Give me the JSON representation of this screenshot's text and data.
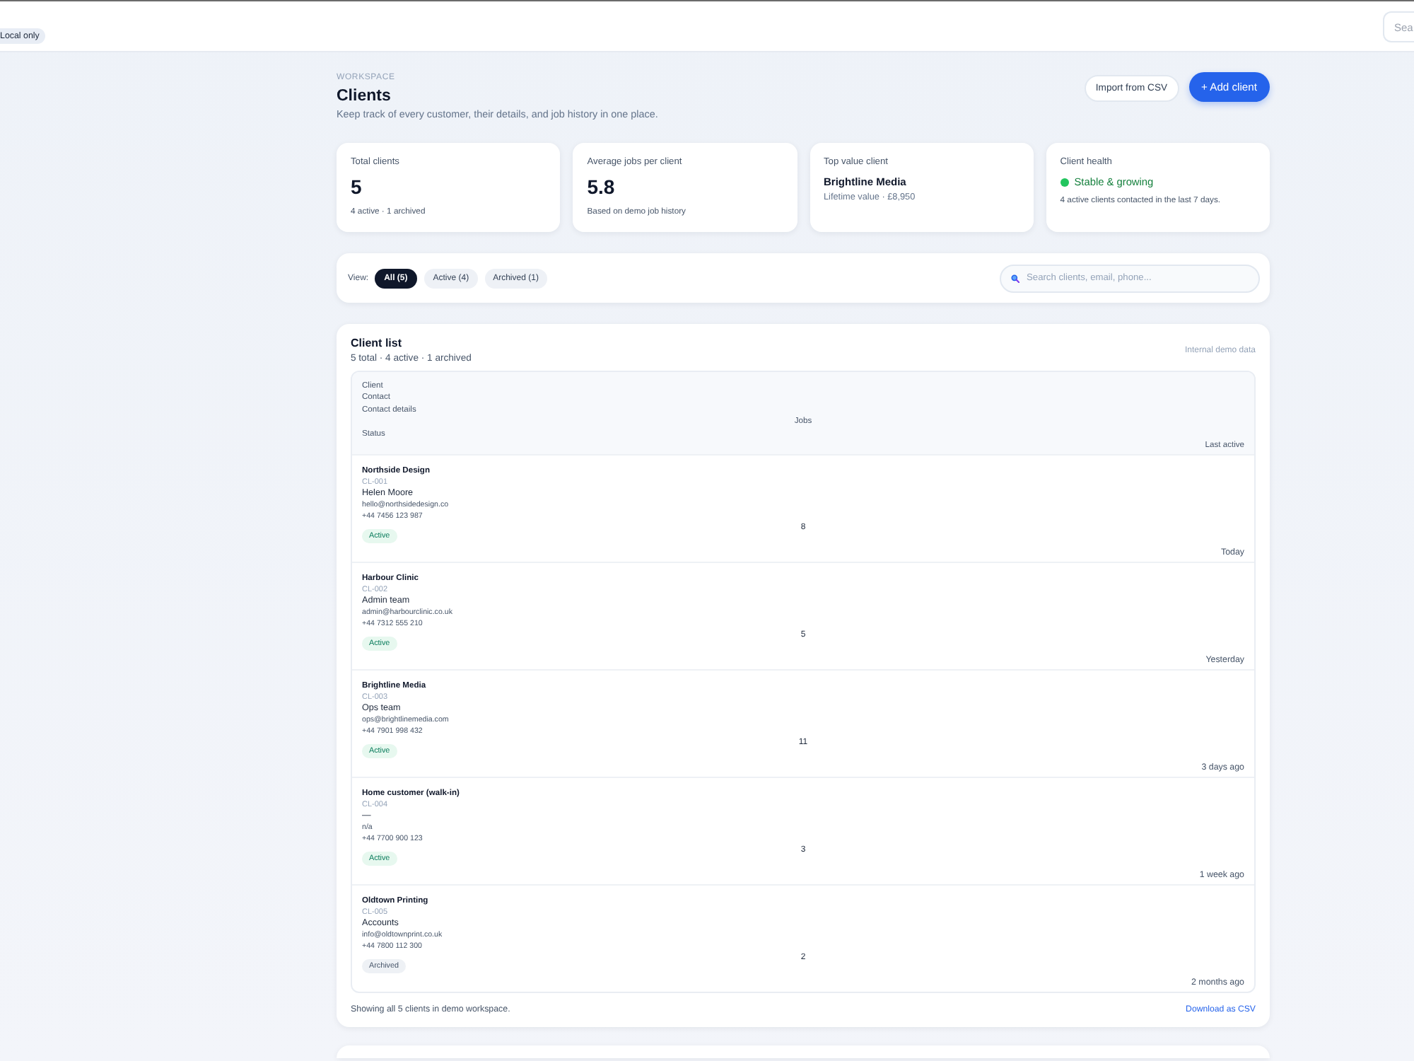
{
  "top_bar": {
    "badge": "Local only",
    "search": {
      "placeholder": "Sea"
    }
  },
  "header": {
    "eyebrow": "WORKSPACE",
    "title": "Clients",
    "subtitle": "Keep track of every customer, their details, and job history in one place.",
    "buttons": [
      {
        "label": "Import from CSV",
        "kind": "secondary"
      },
      {
        "label": "+ Add client",
        "kind": "primary"
      }
    ]
  },
  "stats": [
    {
      "kind": "number",
      "label": "Total clients",
      "value": "5",
      "note": "4 active · 1 archived"
    },
    {
      "kind": "number",
      "label": "Average jobs per client",
      "value": "5.8",
      "note": "Based on demo job history"
    },
    {
      "kind": "client",
      "label": "Top value client",
      "value": "Brightline Media",
      "note": "Lifetime value · £8,950"
    },
    {
      "kind": "health",
      "label": "Client health",
      "value": "Stable & growing",
      "note": "4 active clients contacted in the last 7 days."
    }
  ],
  "filters": {
    "label": "View:",
    "options": [
      {
        "label": "All (5)",
        "selected": true
      },
      {
        "label": "Active (4)",
        "selected": false
      },
      {
        "label": "Archived (1)",
        "selected": false
      }
    ],
    "search": {
      "placeholder": "Search clients, email, phone..."
    }
  },
  "client_list": {
    "title": "Client list",
    "summary": "5 total · 4 active · 1 archived",
    "note": "Internal demo data",
    "columns": [
      {
        "label": "Client",
        "kind": "text"
      },
      {
        "label": "Contact",
        "kind": "text"
      },
      {
        "label": "Contact details",
        "kind": "text"
      },
      {
        "label": "Jobs",
        "kind": "number"
      },
      {
        "label": "Status",
        "kind": "text"
      },
      {
        "label": "Last active",
        "kind": "date"
      }
    ],
    "rows": [
      {
        "name": "Northside Design",
        "id": "CL-001",
        "contact": "Helen Moore",
        "email": "hello@northsidedesign.co",
        "phone": "+44 7456 123 987",
        "jobs": "8",
        "status": "Active",
        "archived": false,
        "last_active": "Today"
      },
      {
        "name": "Harbour Clinic",
        "id": "CL-002",
        "contact": "Admin team",
        "email": "admin@harbourclinic.co.uk",
        "phone": "+44 7312 555 210",
        "jobs": "5",
        "status": "Active",
        "archived": false,
        "last_active": "Yesterday"
      },
      {
        "name": "Brightline Media",
        "id": "CL-003",
        "contact": "Ops team",
        "email": "ops@brightlinemedia.com",
        "phone": "+44 7901 998 432",
        "jobs": "11",
        "status": "Active",
        "archived": false,
        "last_active": "3 days ago"
      },
      {
        "name": "Home customer (walk-in)",
        "id": "CL-004",
        "contact": "—",
        "email": "n/a",
        "phone": "+44 7700 900 123",
        "jobs": "3",
        "status": "Active",
        "archived": false,
        "last_active": "1 week ago"
      },
      {
        "name": "Oldtown Printing",
        "id": "CL-005",
        "contact": "Accounts",
        "email": "info@oldtownprint.co.uk",
        "phone": "+44 7800 112 300",
        "jobs": "2",
        "status": "Archived",
        "archived": true,
        "last_active": "2 months ago"
      }
    ],
    "footer": "Showing all 5 clients in demo workspace.",
    "download_link": "Download as CSV"
  }
}
